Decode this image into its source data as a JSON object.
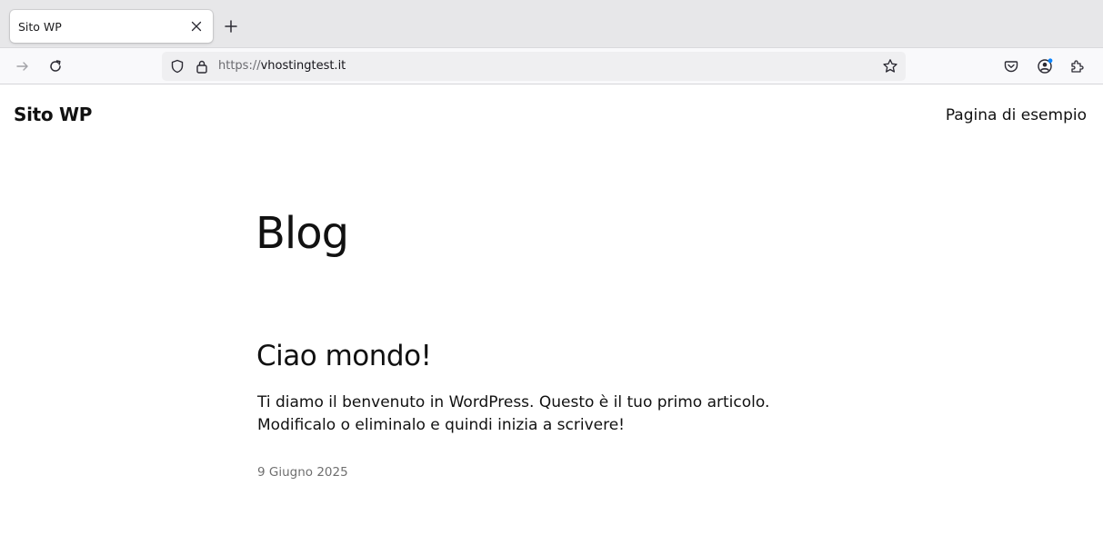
{
  "browser": {
    "tab": {
      "title": "Sito WP"
    },
    "url": {
      "scheme": "https://",
      "host": "vhostingtest.it"
    },
    "icons": {
      "tab_close": "close-icon",
      "new_tab": "plus-icon",
      "forward": "arrow-right-icon",
      "reload": "reload-icon",
      "tracking_protection": "shield-icon",
      "secure": "lock-icon",
      "bookmark": "star-icon",
      "pocket": "pocket-icon",
      "account": "account-icon",
      "extensions": "puzzle-icon"
    },
    "accent_color": "#0a84ff"
  },
  "site": {
    "title": "Sito WP",
    "nav": {
      "items": [
        {
          "label": "Pagina di esempio"
        }
      ]
    },
    "page_heading": "Blog",
    "posts": [
      {
        "title": "Ciao mondo!",
        "excerpt": "Ti diamo il benvenuto in WordPress. Questo è il tuo primo articolo. Modificalo o eliminalo e quindi inizia a scrivere!",
        "date": "9 Giugno 2025"
      }
    ]
  }
}
